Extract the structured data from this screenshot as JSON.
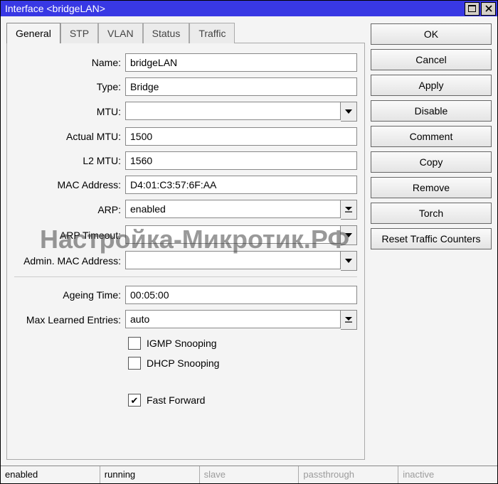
{
  "title": "Interface <bridgeLAN>",
  "tabs": [
    "General",
    "STP",
    "VLAN",
    "Status",
    "Traffic"
  ],
  "active_tab": 0,
  "form": {
    "name_label": "Name:",
    "name_value": "bridgeLAN",
    "type_label": "Type:",
    "type_value": "Bridge",
    "mtu_label": "MTU:",
    "mtu_value": "",
    "actual_mtu_label": "Actual MTU:",
    "actual_mtu_value": "1500",
    "l2_mtu_label": "L2 MTU:",
    "l2_mtu_value": "1560",
    "mac_label": "MAC Address:",
    "mac_value": "D4:01:C3:57:6F:AA",
    "arp_label": "ARP:",
    "arp_value": "enabled",
    "arp_timeout_label": "ARP Timeout:",
    "arp_timeout_value": "",
    "admin_mac_label": "Admin. MAC Address:",
    "admin_mac_value": "",
    "ageing_label": "Ageing Time:",
    "ageing_value": "00:05:00",
    "max_learned_label": "Max Learned Entries:",
    "max_learned_value": "auto",
    "igmp_label": "IGMP Snooping",
    "igmp_checked": false,
    "dhcp_label": "DHCP Snooping",
    "dhcp_checked": false,
    "fast_forward_label": "Fast Forward",
    "fast_forward_checked": true
  },
  "buttons": {
    "ok": "OK",
    "cancel": "Cancel",
    "apply": "Apply",
    "disable": "Disable",
    "comment": "Comment",
    "copy": "Copy",
    "remove": "Remove",
    "torch": "Torch",
    "reset": "Reset Traffic Counters"
  },
  "status": {
    "enabled": "enabled",
    "running": "running",
    "slave": "slave",
    "passthrough": "passthrough",
    "inactive": "inactive"
  },
  "watermark": "Настройка-Микротик.РФ"
}
